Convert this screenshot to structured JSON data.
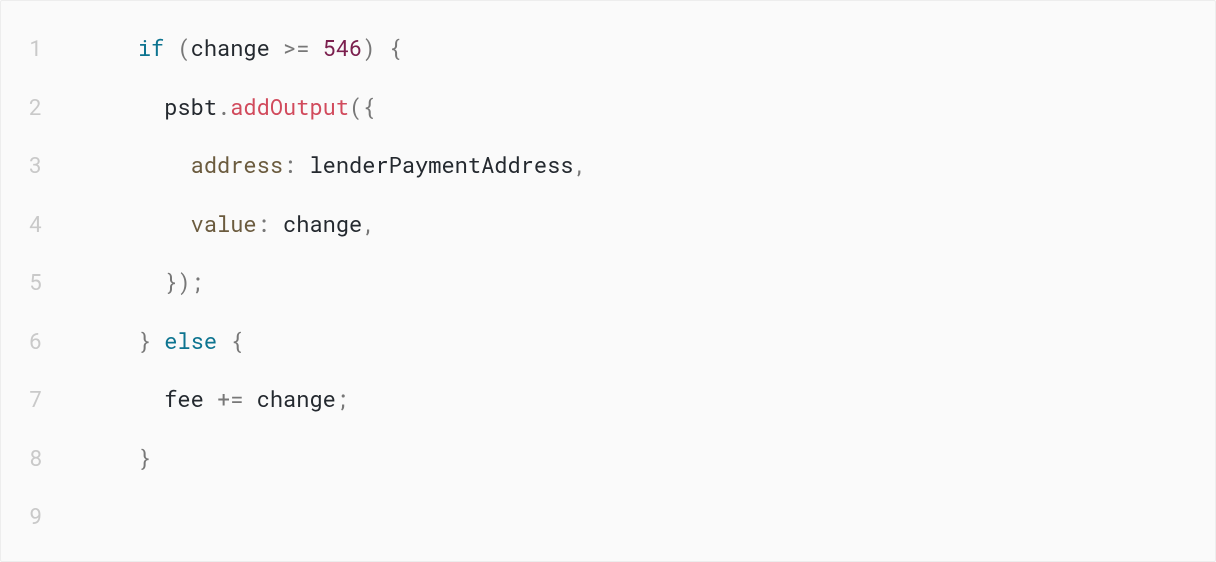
{
  "code": {
    "lines": [
      {
        "num": "1",
        "indent": "    ",
        "tokens": [
          {
            "cls": "tok-keyword",
            "text": "if"
          },
          {
            "cls": "tok-ident",
            "text": " "
          },
          {
            "cls": "tok-punct",
            "text": "("
          },
          {
            "cls": "tok-ident",
            "text": "change "
          },
          {
            "cls": "tok-op",
            "text": ">="
          },
          {
            "cls": "tok-ident",
            "text": " "
          },
          {
            "cls": "tok-number",
            "text": "546"
          },
          {
            "cls": "tok-punct",
            "text": ")"
          },
          {
            "cls": "tok-ident",
            "text": " "
          },
          {
            "cls": "tok-punct",
            "text": "{"
          }
        ]
      },
      {
        "num": "2",
        "indent": "      ",
        "tokens": [
          {
            "cls": "tok-ident",
            "text": "psbt"
          },
          {
            "cls": "tok-punct",
            "text": "."
          },
          {
            "cls": "tok-method",
            "text": "addOutput"
          },
          {
            "cls": "tok-punct",
            "text": "({"
          }
        ]
      },
      {
        "num": "3",
        "indent": "        ",
        "tokens": [
          {
            "cls": "tok-prop",
            "text": "address"
          },
          {
            "cls": "tok-punct",
            "text": ":"
          },
          {
            "cls": "tok-ident",
            "text": " lenderPaymentAddress"
          },
          {
            "cls": "tok-punct",
            "text": ","
          }
        ]
      },
      {
        "num": "4",
        "indent": "        ",
        "tokens": [
          {
            "cls": "tok-prop",
            "text": "value"
          },
          {
            "cls": "tok-punct",
            "text": ":"
          },
          {
            "cls": "tok-ident",
            "text": " change"
          },
          {
            "cls": "tok-punct",
            "text": ","
          }
        ]
      },
      {
        "num": "5",
        "indent": "      ",
        "tokens": [
          {
            "cls": "tok-punct",
            "text": "});"
          }
        ]
      },
      {
        "num": "6",
        "indent": "    ",
        "tokens": [
          {
            "cls": "tok-punct",
            "text": "}"
          },
          {
            "cls": "tok-ident",
            "text": " "
          },
          {
            "cls": "tok-keyword",
            "text": "else"
          },
          {
            "cls": "tok-ident",
            "text": " "
          },
          {
            "cls": "tok-punct",
            "text": "{"
          }
        ]
      },
      {
        "num": "7",
        "indent": "      ",
        "tokens": [
          {
            "cls": "tok-ident",
            "text": "fee "
          },
          {
            "cls": "tok-op",
            "text": "+="
          },
          {
            "cls": "tok-ident",
            "text": " change"
          },
          {
            "cls": "tok-punct",
            "text": ";"
          }
        ]
      },
      {
        "num": "8",
        "indent": "    ",
        "tokens": [
          {
            "cls": "tok-punct",
            "text": "}"
          }
        ]
      },
      {
        "num": "9",
        "indent": "",
        "tokens": []
      }
    ]
  }
}
